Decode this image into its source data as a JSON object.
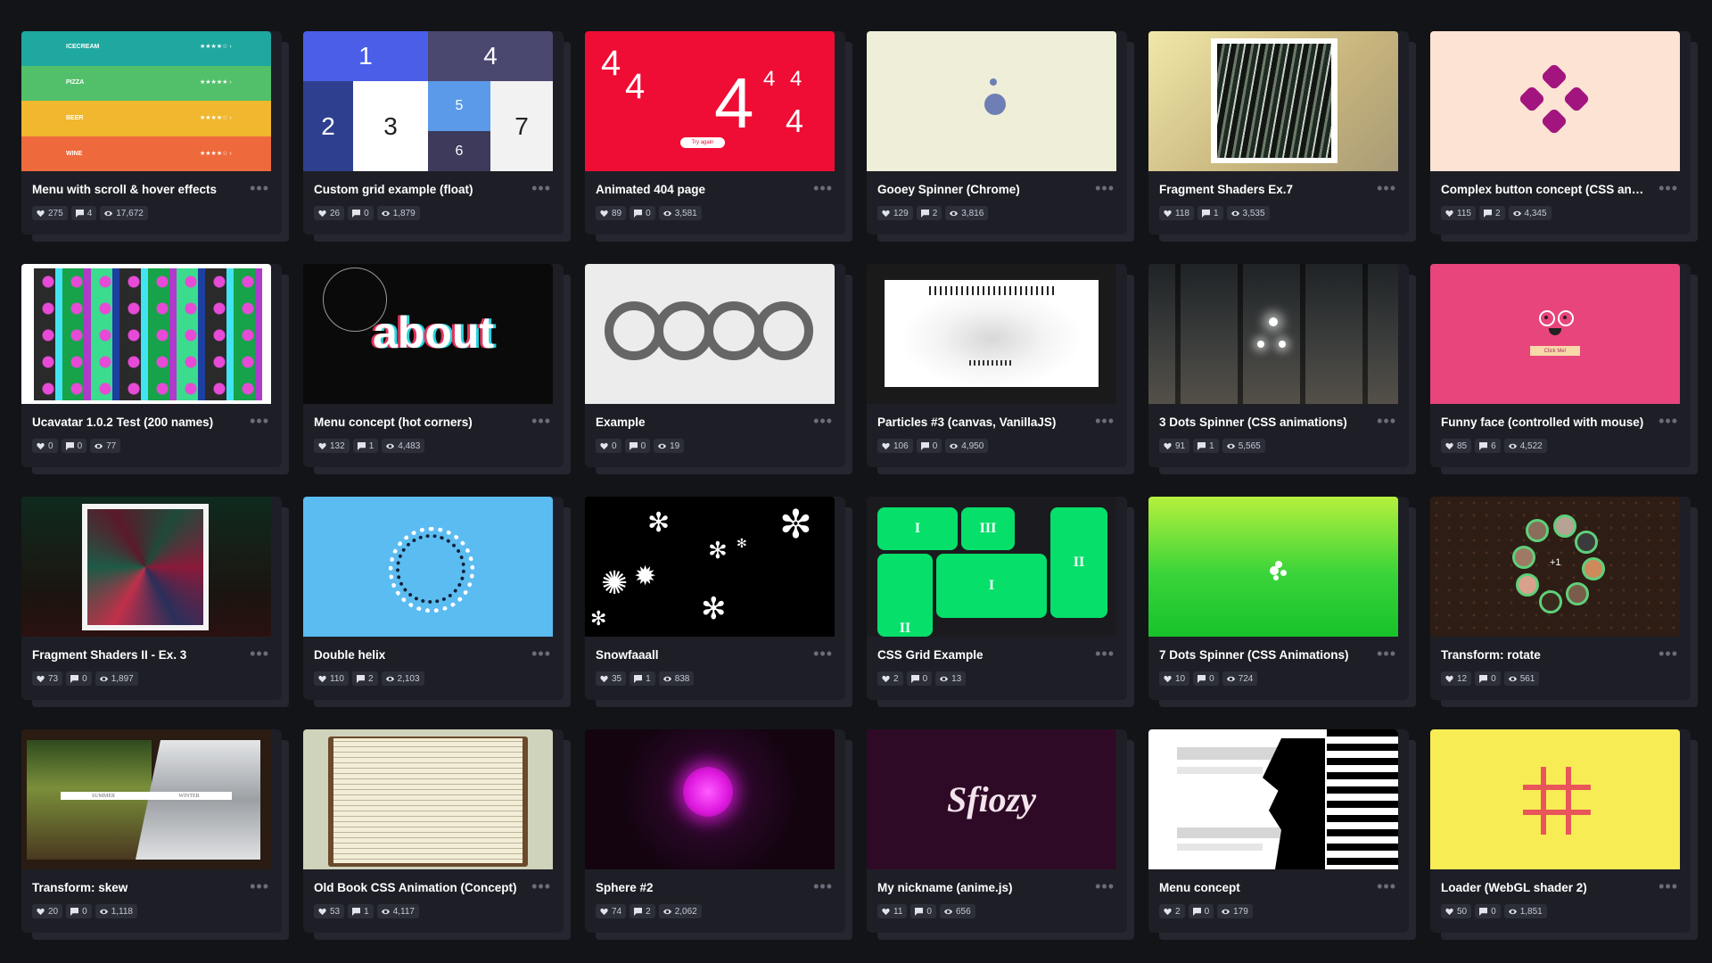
{
  "pens": [
    {
      "title": "Menu with scroll & hover effects",
      "likes": "275",
      "comments": "4",
      "views": "17,672",
      "menu": [
        {
          "label": "ICECREAM",
          "color": "#1fa8a0"
        },
        {
          "label": "PIZZA",
          "color": "#52c06a"
        },
        {
          "label": "BEER",
          "color": "#f0b72f"
        },
        {
          "label": "WINE",
          "color": "#ee6a3c"
        }
      ]
    },
    {
      "title": "Custom grid example (float)",
      "likes": "26",
      "comments": "0",
      "views": "1,879",
      "cells": [
        "1",
        "4",
        "2",
        "3",
        "5",
        "6",
        "7"
      ]
    },
    {
      "title": "Animated 404 page",
      "likes": "89",
      "comments": "0",
      "views": "3,581",
      "glyph": "4",
      "cta": "Try again"
    },
    {
      "title": "Gooey Spinner (Chrome)",
      "likes": "129",
      "comments": "2",
      "views": "3,816"
    },
    {
      "title": "Fragment Shaders Ex.7",
      "likes": "118",
      "comments": "1",
      "views": "3,535"
    },
    {
      "title": "Complex button concept (CSS animations)",
      "likes": "115",
      "comments": "2",
      "views": "4,345"
    },
    {
      "title": "Ucavatar 1.0.2 Test (200 names)",
      "likes": "0",
      "comments": "0",
      "views": "77"
    },
    {
      "title": "Menu concept (hot corners)",
      "likes": "132",
      "comments": "1",
      "views": "4,483",
      "word": "about"
    },
    {
      "title": "Example",
      "likes": "0",
      "comments": "0",
      "views": "19"
    },
    {
      "title": "Particles #3 (canvas, VanillaJS)",
      "likes": "106",
      "comments": "0",
      "views": "4,950"
    },
    {
      "title": "3 Dots Spinner (CSS animations)",
      "likes": "91",
      "comments": "1",
      "views": "5,565"
    },
    {
      "title": "Funny face (controlled with mouse)",
      "likes": "85",
      "comments": "6",
      "views": "4,522",
      "button": "Click Me!"
    },
    {
      "title": "Fragment Shaders II - Ex. 3",
      "likes": "73",
      "comments": "0",
      "views": "1,897"
    },
    {
      "title": "Double helix",
      "likes": "110",
      "comments": "2",
      "views": "2,103"
    },
    {
      "title": "Snowfaaall",
      "likes": "35",
      "comments": "1",
      "views": "838"
    },
    {
      "title": "CSS Grid Example",
      "likes": "2",
      "comments": "0",
      "views": "13",
      "tiles": [
        "I",
        "III",
        "II",
        "I",
        "II"
      ]
    },
    {
      "title": "7 Dots Spinner (CSS Animations)",
      "likes": "10",
      "comments": "0",
      "views": "724"
    },
    {
      "title": "Transform: rotate",
      "likes": "12",
      "comments": "0",
      "views": "561",
      "center": "+1"
    },
    {
      "title": "Transform: skew",
      "likes": "20",
      "comments": "0",
      "views": "1,118",
      "labels": [
        "SUMMER",
        "WINTER"
      ]
    },
    {
      "title": "Old Book CSS Animation (Concept)",
      "likes": "53",
      "comments": "1",
      "views": "4,117"
    },
    {
      "title": "Sphere #2",
      "likes": "74",
      "comments": "2",
      "views": "2,062"
    },
    {
      "title": "My nickname (anime.js)",
      "likes": "11",
      "comments": "0",
      "views": "656",
      "word": "Sfiozy"
    },
    {
      "title": "Menu concept",
      "likes": "2",
      "comments": "0",
      "views": "179"
    },
    {
      "title": "Loader (WebGL shader 2)",
      "likes": "50",
      "comments": "0",
      "views": "1,851"
    }
  ],
  "icons": {
    "likes": "heart-icon",
    "comments": "comment-icon",
    "views": "eye-icon",
    "more": "more-dots-icon"
  }
}
